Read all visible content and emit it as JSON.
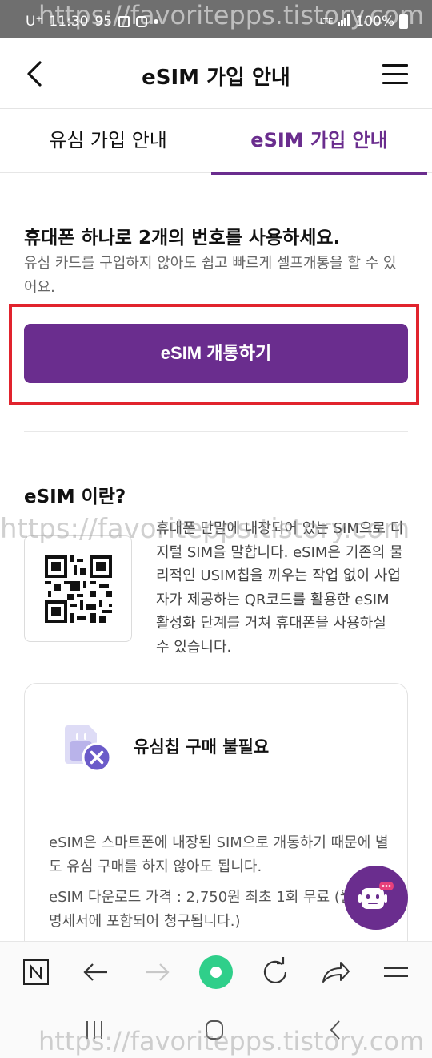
{
  "status_bar": {
    "carrier": "U⁺",
    "time": "11:30",
    "extra": "95",
    "network": "LTE",
    "battery": "100%"
  },
  "header": {
    "title": "eSIM 가입 안내"
  },
  "tabs": [
    {
      "label": "유심 가입 안내",
      "active": false
    },
    {
      "label": "eSIM 가입 안내",
      "active": true
    }
  ],
  "intro": {
    "title": "휴대폰 하나로 2개의 번호를 사용하세요.",
    "desc": "유심 카드를 구입하지 않아도 쉽고 빠르게 셀프개통을 할 수 있어요."
  },
  "cta": {
    "label": "eSIM 개통하기"
  },
  "about": {
    "title": "eSIM 이란?",
    "desc": "휴대폰 단말에 내장되어 있는 SIM으로 디지털 SIM을 말합니다. eSIM은 기존의 물리적인 USIM칩을 끼우는 작업 없이 사업자가 제공하는 QR코드를 활용한 eSIM 활성화 단계를 거쳐 휴대폰을 사용하실 수 있습니다."
  },
  "feature": {
    "title": "유심칩 구매 불필요",
    "p1": "eSIM은 스마트폰에 내장된 SIM으로 개통하기 때문에 별도 유심 구매를 하지 않아도 됩니다.",
    "p2": "eSIM 다운로드 가격 : 2,750원 최초 1회 무료 (월 요금명세서에 포함되어 청구됩니다.)"
  },
  "watermark": "https://favoritepps.tistory.com",
  "colors": {
    "brand": "#6a2d8e",
    "highlight": "#e1232d",
    "home_button": "#2fcf8a"
  },
  "icons": {
    "toolbar": [
      "n-tab-icon",
      "back-arrow-icon",
      "forward-arrow-icon",
      "home-icon",
      "refresh-icon",
      "share-icon",
      "menu-icon"
    ],
    "navbar": [
      "recent-apps-icon",
      "home-nav-icon",
      "back-nav-icon"
    ]
  }
}
